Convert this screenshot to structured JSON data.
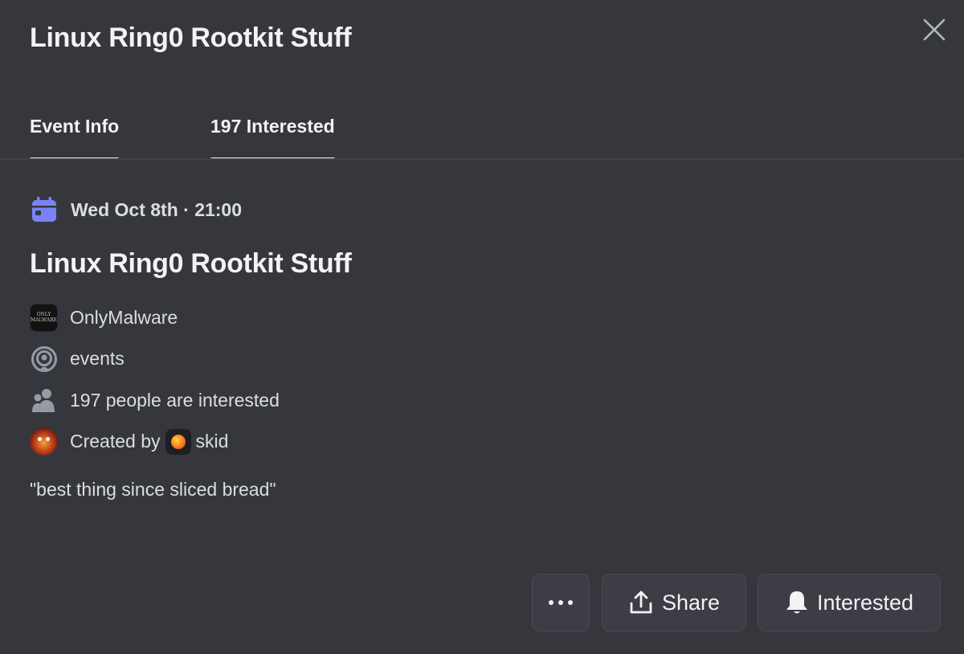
{
  "modal": {
    "title": "Linux Ring0 Rootkit Stuff",
    "close_icon": "close-icon"
  },
  "tabs": [
    {
      "label": "Event Info",
      "active": true
    },
    {
      "label": "197 Interested",
      "active": false
    }
  ],
  "event": {
    "date_icon": "calendar-icon",
    "date": "Wed Oct 8th · 21:00",
    "title": "Linux Ring0 Rootkit Stuff",
    "server": {
      "name": "OnlyMalware",
      "avatar_text_top": "ONLY",
      "avatar_text_bottom": "MALWARE"
    },
    "channel": {
      "icon": "stage-channel-icon",
      "name": "events"
    },
    "interested": {
      "icon": "people-icon",
      "text": "197 people are interested"
    },
    "creator": {
      "prefix": "Created by",
      "name": "skid"
    },
    "description": "\"best thing since sliced bread\""
  },
  "actions": {
    "more_icon": "more-icon",
    "share_label": "Share",
    "share_icon": "share-icon",
    "interested_label": "Interested",
    "interested_icon": "bell-icon"
  },
  "colors": {
    "background": "#36373d",
    "calendar_accent": "#7983f5",
    "button_bg": "#3d3e45"
  }
}
